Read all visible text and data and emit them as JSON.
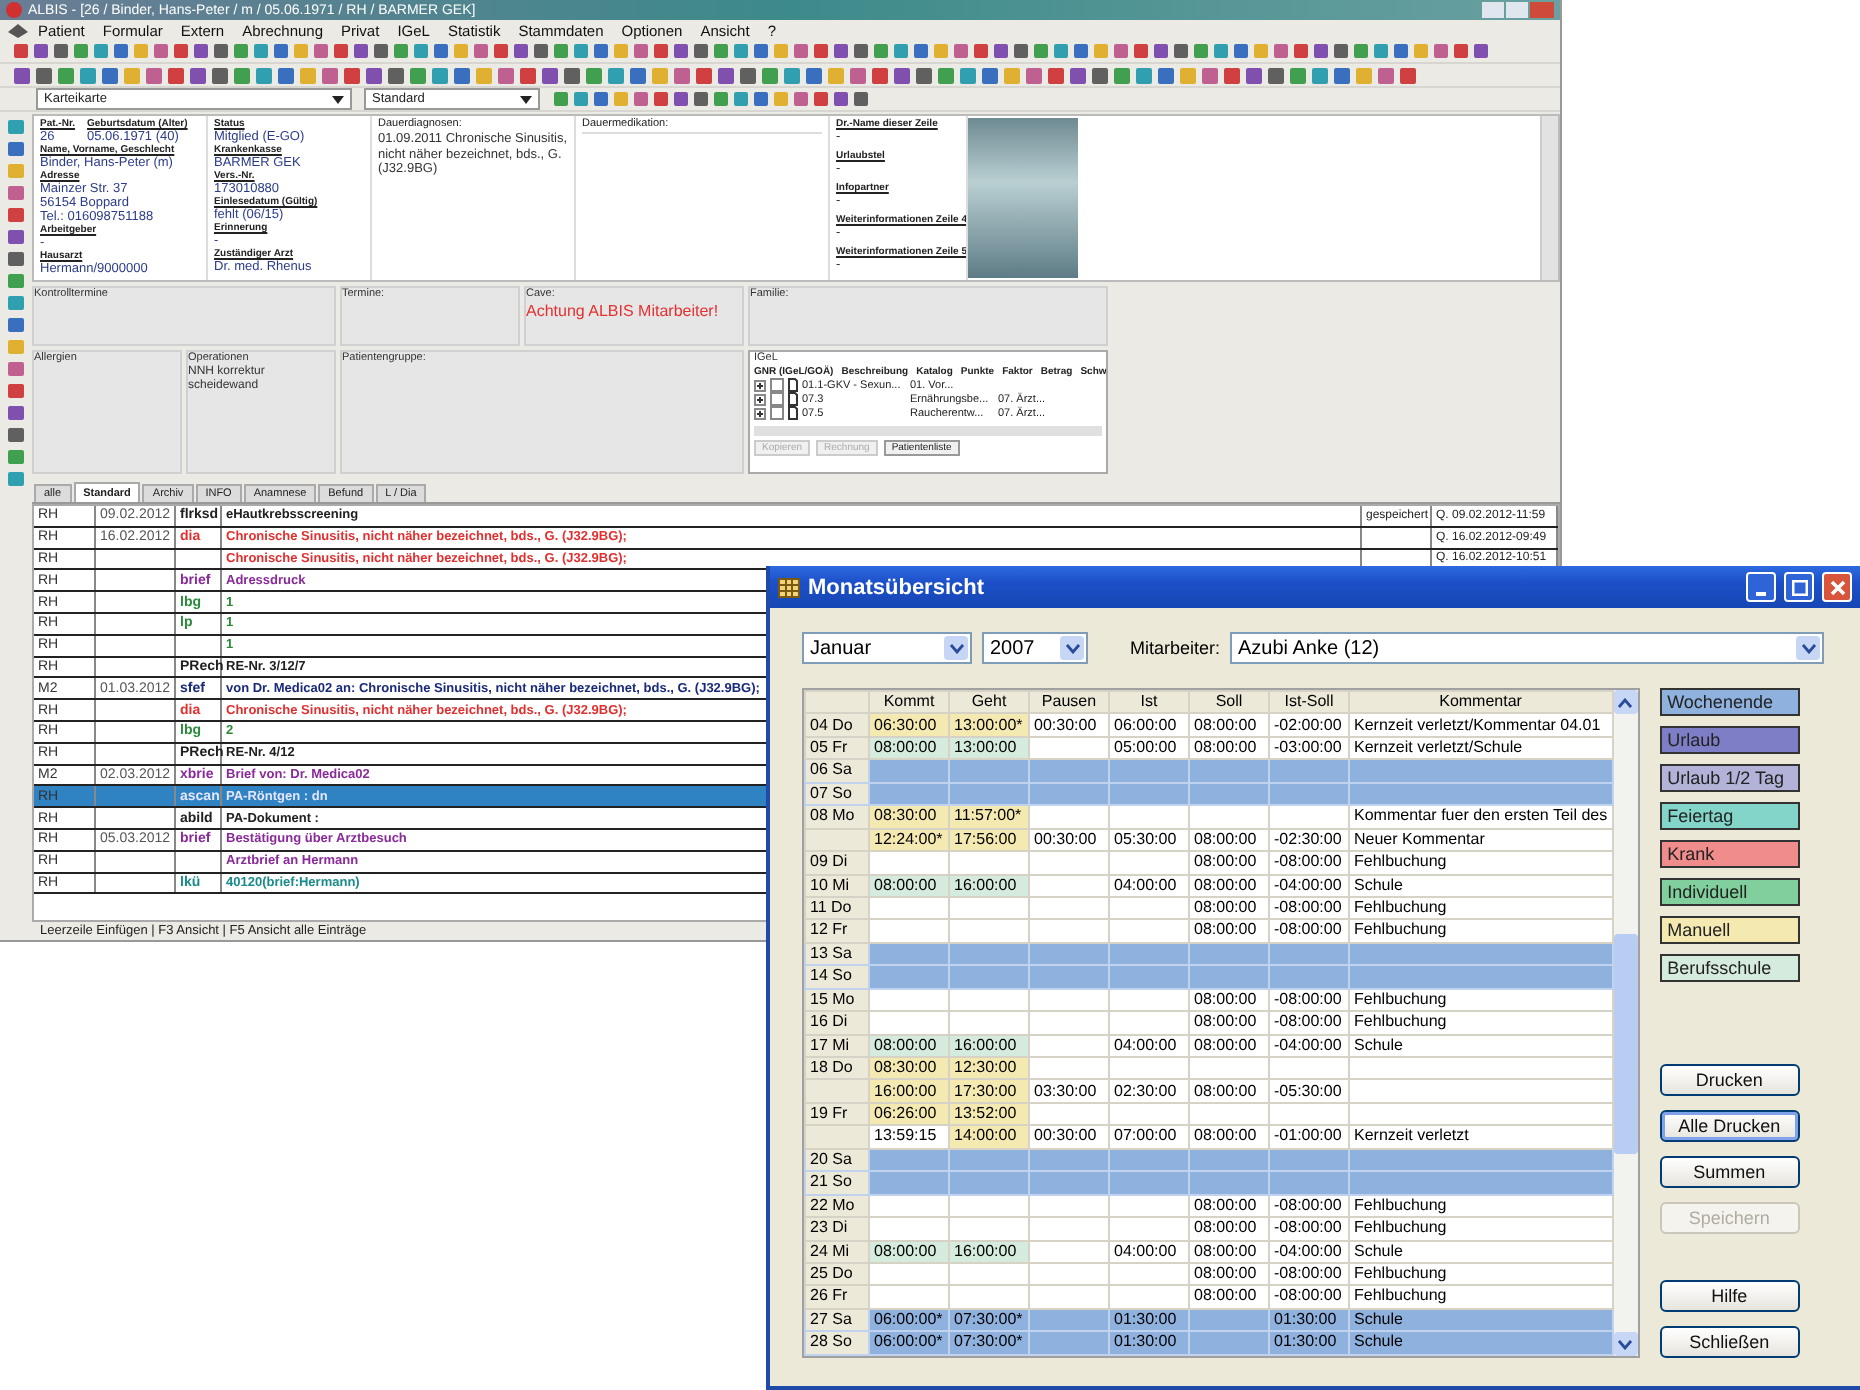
{
  "app": {
    "title": "ALBIS - [26 / Binder, Hans-Peter / m / 05.06.1971 / RH / BARMER GEK]",
    "menu": [
      "Patient",
      "Formular",
      "Extern",
      "Abrechnung",
      "Privat",
      "IGeL",
      "Statistik",
      "Stammdaten",
      "Optionen",
      "Ansicht",
      "?"
    ],
    "view_selects": [
      {
        "value": "Karteikarte"
      },
      {
        "value": "Standard"
      }
    ],
    "patient": {
      "col1_top": [
        {
          "label": "Pat.-Nr.",
          "values": [
            "26"
          ]
        },
        {
          "label": "Geburtsdatum (Alter)",
          "values": [
            "05.06.1971 (40)"
          ]
        }
      ],
      "col1": [
        {
          "label": "Name, Vorname, Geschlecht",
          "values": [
            "Binder, Hans-Peter (m)"
          ]
        },
        {
          "label": "Adresse",
          "values": [
            "Mainzer Str. 37",
            "56154 Boppard",
            "Tel.: 016098751188"
          ]
        },
        {
          "label": "Arbeitgeber",
          "values": [
            "-"
          ]
        },
        {
          "label": "Hausarzt",
          "values": [
            "Hermann/9000000"
          ]
        }
      ],
      "col2": [
        {
          "label": "Status",
          "values": [
            "Mitglied (E-GO)"
          ]
        },
        {
          "label": "Krankenkasse",
          "values": [
            "BARMER GEK"
          ]
        },
        {
          "label": "Vers.-Nr.",
          "values": [
            "173010880"
          ]
        },
        {
          "label": "Einlesedatum (Gültig)",
          "values": [
            "fehlt (06/15)"
          ]
        },
        {
          "label": "Erinnerung",
          "values": [
            "-"
          ]
        },
        {
          "label": "Zuständiger Arzt",
          "values": [
            "Dr. med. Rhenus"
          ]
        }
      ],
      "diagnoses": {
        "label": "Dauerdiagnosen:",
        "text": "01.09.2011 Chronische Sinusitis, nicht näher bezeichnet, bds., G. (J32.9BG)"
      },
      "medication": {
        "label": "Dauermedikation:"
      },
      "col5": [
        {
          "label": "Dr.-Name dieser Zeile",
          "values": [
            "-"
          ]
        },
        {
          "label": "Urlaubstel",
          "values": [
            "-"
          ]
        },
        {
          "label": "Infopartner",
          "values": [
            "-"
          ]
        },
        {
          "label": "Weiterinformationen Zeile 4",
          "values": [
            "-"
          ]
        },
        {
          "label": "Weiterinformationen Zeile 5",
          "values": [
            "-"
          ]
        }
      ]
    },
    "panels": {
      "controls": "Kontrolltermine",
      "appointments": "Termine:",
      "cave": {
        "label": "Cave:",
        "text": "Achtung ALBIS Mitarbeiter!"
      },
      "family": "Familie:",
      "allergies": "Allergien",
      "operations": {
        "label": "Operationen",
        "lines": [
          "NNH korrektur",
          "scheidewand"
        ]
      },
      "group": "Patientengruppe:",
      "igel": {
        "title": "IGeL",
        "columns": [
          "GNR (IGeL/GOÄ)",
          "Beschreibung",
          "Katalog",
          "Punkte",
          "Faktor",
          "Betrag",
          "Schw"
        ],
        "rows": [
          {
            "gnr": "01.1-GKV - Sexun...",
            "desc": "01. Vor...",
            "checked": false
          },
          {
            "gnr": "07.3",
            "desc": "Ernährungsbe...",
            "catalog": "07. Ärzt...",
            "checked": false
          },
          {
            "gnr": "07.5",
            "desc": "Raucherentw...",
            "catalog": "07. Ärzt...",
            "checked": false
          }
        ],
        "buttons": [
          {
            "label": "Kopieren",
            "disabled": true
          },
          {
            "label": "Rechnung",
            "disabled": true
          },
          {
            "label": "Patientenliste",
            "disabled": false
          }
        ]
      }
    },
    "tabs": [
      {
        "label": "alle",
        "selected": false
      },
      {
        "label": "Standard",
        "selected": true
      },
      {
        "label": "Archiv",
        "selected": false
      },
      {
        "label": "INFO",
        "selected": false
      },
      {
        "label": "Anamnese",
        "selected": false
      },
      {
        "label": "Befund",
        "selected": false
      },
      {
        "label": "L / Dia",
        "selected": false
      }
    ],
    "journal": [
      {
        "user": "RH",
        "date": "09.02.2012",
        "type": "flrksd",
        "text": "eHautkrebsscreening",
        "color": "#202020",
        "selected": false,
        "status": "gespeichert",
        "stamp": "Q. 09.02.2012-11:59"
      },
      {
        "user": "RH",
        "date": "16.02.2012",
        "type": "dia",
        "text": "Chronische Sinusitis, nicht näher bezeichnet, bds., G. (J32.9BG);",
        "color": "#e03030",
        "selected": false,
        "stamp": "Q. 16.02.2012-09:49"
      },
      {
        "user": "RH",
        "text": "Chronische Sinusitis, nicht näher bezeichnet, bds., G. (J32.9BG);",
        "color": "#e03030",
        "selected": false,
        "stamp": "Q. 16.02.2012-10:51"
      },
      {
        "user": "RH",
        "type": "brief",
        "text": "Adressdruck",
        "color": "#8a2a9a",
        "selected": false
      },
      {
        "user": "RH",
        "type": "lbg",
        "text": "1",
        "color": "#2a8a3a",
        "selected": false
      },
      {
        "user": "RH",
        "type": "lp",
        "text": "1",
        "color": "#2a8a3a",
        "selected": false
      },
      {
        "user": "RH",
        "text": "1",
        "color": "#2a8a3a",
        "selected": false
      },
      {
        "user": "RH",
        "type": "PRech",
        "text": "RE-Nr. 3/12/7",
        "color": "#202020",
        "selected": false
      },
      {
        "user": "M2",
        "date": "01.03.2012",
        "type": "sfef",
        "text": "von Dr. Medica02 an: Chronische Sinusitis, nicht näher bezeichnet, bds., G. (J32.9BG);",
        "color": "#1a2a7a",
        "selected": false
      },
      {
        "user": "RH",
        "type": "dia",
        "text": "Chronische Sinusitis, nicht näher bezeichnet, bds., G. (J32.9BG);",
        "color": "#e03030",
        "selected": false
      },
      {
        "user": "RH",
        "type": "lbg",
        "text": "2",
        "color": "#2a8a3a",
        "selected": false
      },
      {
        "user": "RH",
        "type": "PRech",
        "text": "RE-Nr. 4/12",
        "color": "#202020",
        "selected": false
      },
      {
        "user": "M2",
        "date": "02.03.2012",
        "type": "xbrie",
        "text": "Brief von: Dr. Medica02",
        "color": "#8a2a9a",
        "selected": false
      },
      {
        "user": "RH",
        "type": "ascan",
        "text": "PA-Röntgen : dn",
        "color": "#e6e6ff",
        "selected": true
      },
      {
        "user": "RH",
        "type": "abild",
        "text": "PA-Dokument :",
        "color": "#202020",
        "selected": false
      },
      {
        "user": "RH",
        "date": "05.03.2012",
        "type": "brief",
        "text": "Bestätigung über Arztbesuch",
        "color": "#8a2a9a",
        "selected": false
      },
      {
        "user": "RH",
        "text": "Arztbrief an Hermann",
        "color": "#8a2a9a",
        "selected": false
      },
      {
        "user": "RH",
        "type": "lkü",
        "text": "40120(brief:Hermann)",
        "color": "#1a8a8a",
        "selected": false
      }
    ],
    "status_bar": "Leerzeile Einfügen | F3 Ansicht | F5 Ansicht alle Einträge"
  },
  "dialog": {
    "title": "Monatsübersicht",
    "month": "Januar",
    "year": "2007",
    "employee_label": "Mitarbeiter:",
    "employee": "Azubi Anke (12)",
    "columns": [
      "Kommt",
      "Geht",
      "Pausen",
      "Ist",
      "Soll",
      "Ist-Soll",
      "Kommentar"
    ],
    "rows": [
      {
        "day": "04 Do",
        "kind": "normal",
        "cells": [
          {
            "text": "06:30:00",
            "color": "#f5e9b2"
          },
          {
            "text": "13:00:00*",
            "color": "#f5e9b2"
          },
          {
            "text": "00:30:00"
          },
          {
            "text": "06:00:00"
          },
          {
            "text": "08:00:00"
          },
          {
            "text": "-02:00:00"
          },
          {
            "text": "Kernzeit verletzt/Kommentar 04.01"
          }
        ]
      },
      {
        "day": "05 Fr",
        "kind": "normal",
        "cells": [
          {
            "text": "08:00:00",
            "color": "#d5ebdd"
          },
          {
            "text": "13:00:00",
            "color": "#d5ebdd"
          },
          {},
          {
            "text": "05:00:00"
          },
          {
            "text": "08:00:00"
          },
          {
            "text": "-03:00:00"
          },
          {
            "text": "Kernzeit verletzt/Schule"
          }
        ]
      },
      {
        "day": "06 Sa",
        "kind": "weekend",
        "cells": []
      },
      {
        "day": "07 So",
        "kind": "weekend",
        "cells": []
      },
      {
        "day": "08 Mo",
        "kind": "normal",
        "cells": [
          {
            "text": "08:30:00",
            "color": "#f5e9b2"
          },
          {
            "text": "11:57:00*",
            "color": "#f5e9b2"
          },
          {},
          {},
          {},
          {},
          {
            "text": "Kommentar fuer den ersten Teil des"
          }
        ]
      },
      {
        "kind": "normal",
        "cells": [
          {
            "text": "12:24:00*",
            "color": "#f5e9b2"
          },
          {
            "text": "17:56:00",
            "color": "#f5e9b2"
          },
          {
            "text": "00:30:00"
          },
          {
            "text": "05:30:00"
          },
          {
            "text": "08:00:00"
          },
          {
            "text": "-02:30:00"
          },
          {
            "text": "Neuer Kommentar"
          }
        ]
      },
      {
        "day": "09 Di",
        "kind": "normal",
        "cells": [
          {},
          {},
          {},
          {},
          {
            "text": "08:00:00"
          },
          {
            "text": "-08:00:00"
          },
          {
            "text": "Fehlbuchung"
          }
        ]
      },
      {
        "day": "10 Mi",
        "kind": "normal",
        "cells": [
          {
            "text": "08:00:00",
            "color": "#d5ebdd"
          },
          {
            "text": "16:00:00",
            "color": "#d5ebdd"
          },
          {},
          {
            "text": "04:00:00"
          },
          {
            "text": "08:00:00"
          },
          {
            "text": "-04:00:00"
          },
          {
            "text": "Schule"
          }
        ]
      },
      {
        "day": "11 Do",
        "kind": "normal",
        "cells": [
          {},
          {},
          {},
          {},
          {
            "text": "08:00:00"
          },
          {
            "text": "-08:00:00"
          },
          {
            "text": "Fehlbuchung"
          }
        ]
      },
      {
        "day": "12 Fr",
        "kind": "normal",
        "cells": [
          {},
          {},
          {},
          {},
          {
            "text": "08:00:00"
          },
          {
            "text": "-08:00:00"
          },
          {
            "text": "Fehlbuchung"
          }
        ]
      },
      {
        "day": "13 Sa",
        "kind": "weekend",
        "cells": []
      },
      {
        "day": "14 So",
        "kind": "weekend",
        "cells": []
      },
      {
        "day": "15 Mo",
        "kind": "normal",
        "cells": [
          {},
          {},
          {},
          {},
          {
            "text": "08:00:00"
          },
          {
            "text": "-08:00:00"
          },
          {
            "text": "Fehlbuchung"
          }
        ]
      },
      {
        "day": "16 Di",
        "kind": "normal",
        "cells": [
          {},
          {},
          {},
          {},
          {
            "text": "08:00:00"
          },
          {
            "text": "-08:00:00"
          },
          {
            "text": "Fehlbuchung"
          }
        ]
      },
      {
        "day": "17 Mi",
        "kind": "normal",
        "cells": [
          {
            "text": "08:00:00",
            "color": "#d5ebdd"
          },
          {
            "text": "16:00:00",
            "color": "#d5ebdd"
          },
          {},
          {
            "text": "04:00:00"
          },
          {
            "text": "08:00:00"
          },
          {
            "text": "-04:00:00"
          },
          {
            "text": "Schule"
          }
        ]
      },
      {
        "day": "18 Do",
        "kind": "normal",
        "cells": [
          {
            "text": "08:30:00",
            "color": "#f5e9b2"
          },
          {
            "text": "12:30:00",
            "color": "#f5e9b2"
          },
          {},
          {},
          {},
          {},
          {}
        ]
      },
      {
        "kind": "normal",
        "cells": [
          {
            "text": "16:00:00",
            "color": "#f5e9b2"
          },
          {
            "text": "17:30:00",
            "color": "#f5e9b2"
          },
          {
            "text": "03:30:00"
          },
          {
            "text": "02:30:00"
          },
          {
            "text": "08:00:00"
          },
          {
            "text": "-05:30:00"
          },
          {}
        ]
      },
      {
        "day": "19 Fr",
        "kind": "normal",
        "cells": [
          {
            "text": "06:26:00",
            "color": "#f5e9b2"
          },
          {
            "text": "13:52:00",
            "color": "#f5e9b2"
          },
          {},
          {},
          {},
          {},
          {}
        ]
      },
      {
        "kind": "normal",
        "cells": [
          {
            "text": "13:59:15"
          },
          {
            "text": "14:00:00",
            "color": "#f5e9b2"
          },
          {
            "text": "00:30:00"
          },
          {
            "text": "07:00:00"
          },
          {
            "text": "08:00:00"
          },
          {
            "text": "-01:00:00"
          },
          {
            "text": "Kernzeit verletzt"
          }
        ]
      },
      {
        "day": "20 Sa",
        "kind": "weekend",
        "cells": []
      },
      {
        "day": "21 So",
        "kind": "weekend",
        "cells": []
      },
      {
        "day": "22 Mo",
        "kind": "normal",
        "cells": [
          {},
          {},
          {},
          {},
          {
            "text": "08:00:00"
          },
          {
            "text": "-08:00:00"
          },
          {
            "text": "Fehlbuchung"
          }
        ]
      },
      {
        "day": "23 Di",
        "kind": "normal",
        "cells": [
          {},
          {},
          {},
          {},
          {
            "text": "08:00:00"
          },
          {
            "text": "-08:00:00"
          },
          {
            "text": "Fehlbuchung"
          }
        ]
      },
      {
        "day": "24 Mi",
        "kind": "normal",
        "cells": [
          {
            "text": "08:00:00",
            "color": "#d5ebdd"
          },
          {
            "text": "16:00:00",
            "color": "#d5ebdd"
          },
          {},
          {
            "text": "04:00:00"
          },
          {
            "text": "08:00:00"
          },
          {
            "text": "-04:00:00"
          },
          {
            "text": "Schule"
          }
        ]
      },
      {
        "day": "25 Do",
        "kind": "normal",
        "cells": [
          {},
          {},
          {},
          {},
          {
            "text": "08:00:00"
          },
          {
            "text": "-08:00:00"
          },
          {
            "text": "Fehlbuchung"
          }
        ]
      },
      {
        "day": "26 Fr",
        "kind": "normal",
        "cells": [
          {},
          {},
          {},
          {},
          {
            "text": "08:00:00"
          },
          {
            "text": "-08:00:00"
          },
          {
            "text": "Fehlbuchung"
          }
        ]
      },
      {
        "day": "27 Sa",
        "kind": "weekend",
        "cells": [
          {
            "text": "06:00:00*"
          },
          {
            "text": "07:30:00*"
          },
          {},
          {
            "text": "01:30:00"
          },
          {},
          {
            "text": "01:30:00"
          },
          {
            "text": "Schule"
          }
        ]
      },
      {
        "day": "28 So",
        "kind": "weekend",
        "cells": [
          {
            "text": "06:00:00*"
          },
          {
            "text": "07:30:00*"
          },
          {},
          {
            "text": "01:30:00"
          },
          {},
          {
            "text": "01:30:00"
          },
          {
            "text": "Schule"
          }
        ]
      }
    ],
    "legend": [
      {
        "label": "Wochenende",
        "color": "#8fb1de"
      },
      {
        "label": "Urlaub",
        "color": "#7e7ec6"
      },
      {
        "label": "Urlaub 1/2 Tag",
        "color": "#b3b3d9"
      },
      {
        "label": "Feiertag",
        "color": "#82d5c8"
      },
      {
        "label": "Krank",
        "color": "#f08c8c"
      },
      {
        "label": "Individuell",
        "color": "#80cf9c"
      },
      {
        "label": "Manuell",
        "color": "#f5e9b2"
      },
      {
        "label": "Berufsschule",
        "color": "#d5ebdd"
      }
    ],
    "buttons": [
      {
        "label": "Drucken",
        "disabled": false,
        "focused": false
      },
      {
        "label": "Alle Drucken",
        "disabled": false,
        "focused": true
      },
      {
        "label": "Summen",
        "disabled": false,
        "focused": false
      },
      {
        "label": "Speichern",
        "disabled": true,
        "focused": false
      },
      {
        "label": "Hilfe",
        "disabled": false,
        "focused": false
      },
      {
        "label": "Schließen",
        "disabled": false,
        "focused": false
      }
    ]
  }
}
